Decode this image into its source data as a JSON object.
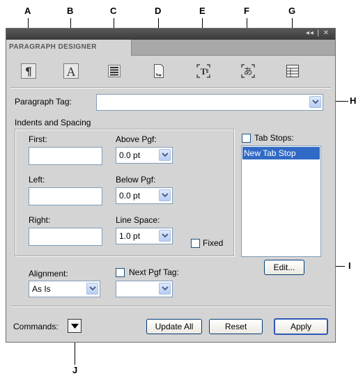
{
  "callouts": {
    "a": "A",
    "b": "B",
    "c": "C",
    "d": "D",
    "e": "E",
    "f": "F",
    "g": "G",
    "h": "H",
    "i": "I",
    "j": "J"
  },
  "panel": {
    "tab_title": "PARAGRAPH DESIGNER",
    "titlebar_controls": "◂◂ | ✕"
  },
  "toolbar_icons": [
    "pilcrow-icon",
    "character-a-icon",
    "text-lines-icon",
    "page-icon",
    "text-frame-icon",
    "asian-text-icon",
    "table-icon"
  ],
  "form": {
    "paragraph_tag_label": "Paragraph Tag:",
    "paragraph_tag_value": "",
    "indents_heading": "Indents and Spacing",
    "first_label": "First:",
    "first_value": "",
    "left_label": "Left:",
    "left_value": "",
    "right_label": "Right:",
    "right_value": "",
    "above_label": "Above Pgf:",
    "above_value": "0.0 pt",
    "below_label": "Below Pgf:",
    "below_value": "0.0 pt",
    "line_space_label": "Line Space:",
    "line_space_value": "1.0 pt",
    "fixed_label": "Fixed",
    "tab_stops_label": "Tab Stops:",
    "tab_stops_items": [
      "New Tab Stop"
    ],
    "edit_label": "Edit...",
    "alignment_label": "Alignment:",
    "alignment_value": "As Is",
    "next_pgf_label": "Next Pgf Tag:",
    "next_pgf_value": ""
  },
  "footer": {
    "commands_label": "Commands:",
    "update_all_label": "Update All",
    "reset_label": "Reset",
    "apply_label": "Apply"
  },
  "colors": {
    "panel_bg": "#d4d4d4",
    "selection": "#316ac5",
    "field_border": "#7f9db9"
  }
}
